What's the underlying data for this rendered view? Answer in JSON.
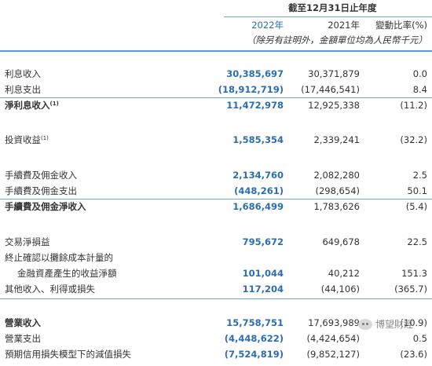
{
  "header": {
    "period": "截至12月31日止年度",
    "col_2022": "2022年",
    "col_2021": "2021年",
    "col_change": "變動比率(%)",
    "unit_note": "（除另有註明外，金額單位均為人民幣千元）"
  },
  "rows": [
    {
      "label": "利息收入",
      "sup": "",
      "v2022": "30,385,697",
      "v2021": "30,371,879",
      "change": "0.0"
    },
    {
      "label": "利息支出",
      "sup": "",
      "v2022": "(18,912,719)",
      "v2021": "(17,446,541)",
      "change": "8.4"
    },
    {
      "label": "淨利息收入",
      "sup": "(1)",
      "v2022": "11,472,978",
      "v2021": "12,925,338",
      "change": "(11.2)"
    },
    {
      "label": "投資收益",
      "sup": "(1)",
      "v2022": "1,585,354",
      "v2021": "2,339,241",
      "change": "(32.2)"
    },
    {
      "label": "手續費及佣金收入",
      "sup": "",
      "v2022": "2,134,760",
      "v2021": "2,082,280",
      "change": "2.5"
    },
    {
      "label": "手續費及佣金支出",
      "sup": "",
      "v2022": "(448,261)",
      "v2021": "(298,654)",
      "change": "50.1"
    },
    {
      "label": "手續費及佣金淨收入",
      "sup": "",
      "v2022": "1,686,499",
      "v2021": "1,783,626",
      "change": "(5.4)"
    },
    {
      "label": "交易淨損益",
      "sup": "",
      "v2022": "795,672",
      "v2021": "649,678",
      "change": "22.5"
    },
    {
      "label": "終止確認以攤餘成本計量的",
      "sup": "",
      "v2022": "",
      "v2021": "",
      "change": ""
    },
    {
      "label": "金融資產產生的收益淨額",
      "sup": "",
      "v2022": "101,044",
      "v2021": "40,212",
      "change": "151.3"
    },
    {
      "label": "其他收入、利得或損失",
      "sup": "",
      "v2022": "117,204",
      "v2021": "(44,106)",
      "change": "(365.7)"
    },
    {
      "label": "營業收入",
      "sup": "",
      "v2022": "15,758,751",
      "v2021": "17,693,989",
      "change": "(10.9)"
    },
    {
      "label": "營業支出",
      "sup": "",
      "v2022": "(4,448,622)",
      "v2021": "(4,424,654)",
      "change": "0.5"
    },
    {
      "label": "預期信用損失模型下的減值損失",
      "sup": "",
      "v2022": "(7,524,819)",
      "v2021": "(9,852,127)",
      "change": "(23.6)"
    }
  ],
  "watermark": {
    "text": "博望財經",
    "icon": "wechat-icon"
  }
}
